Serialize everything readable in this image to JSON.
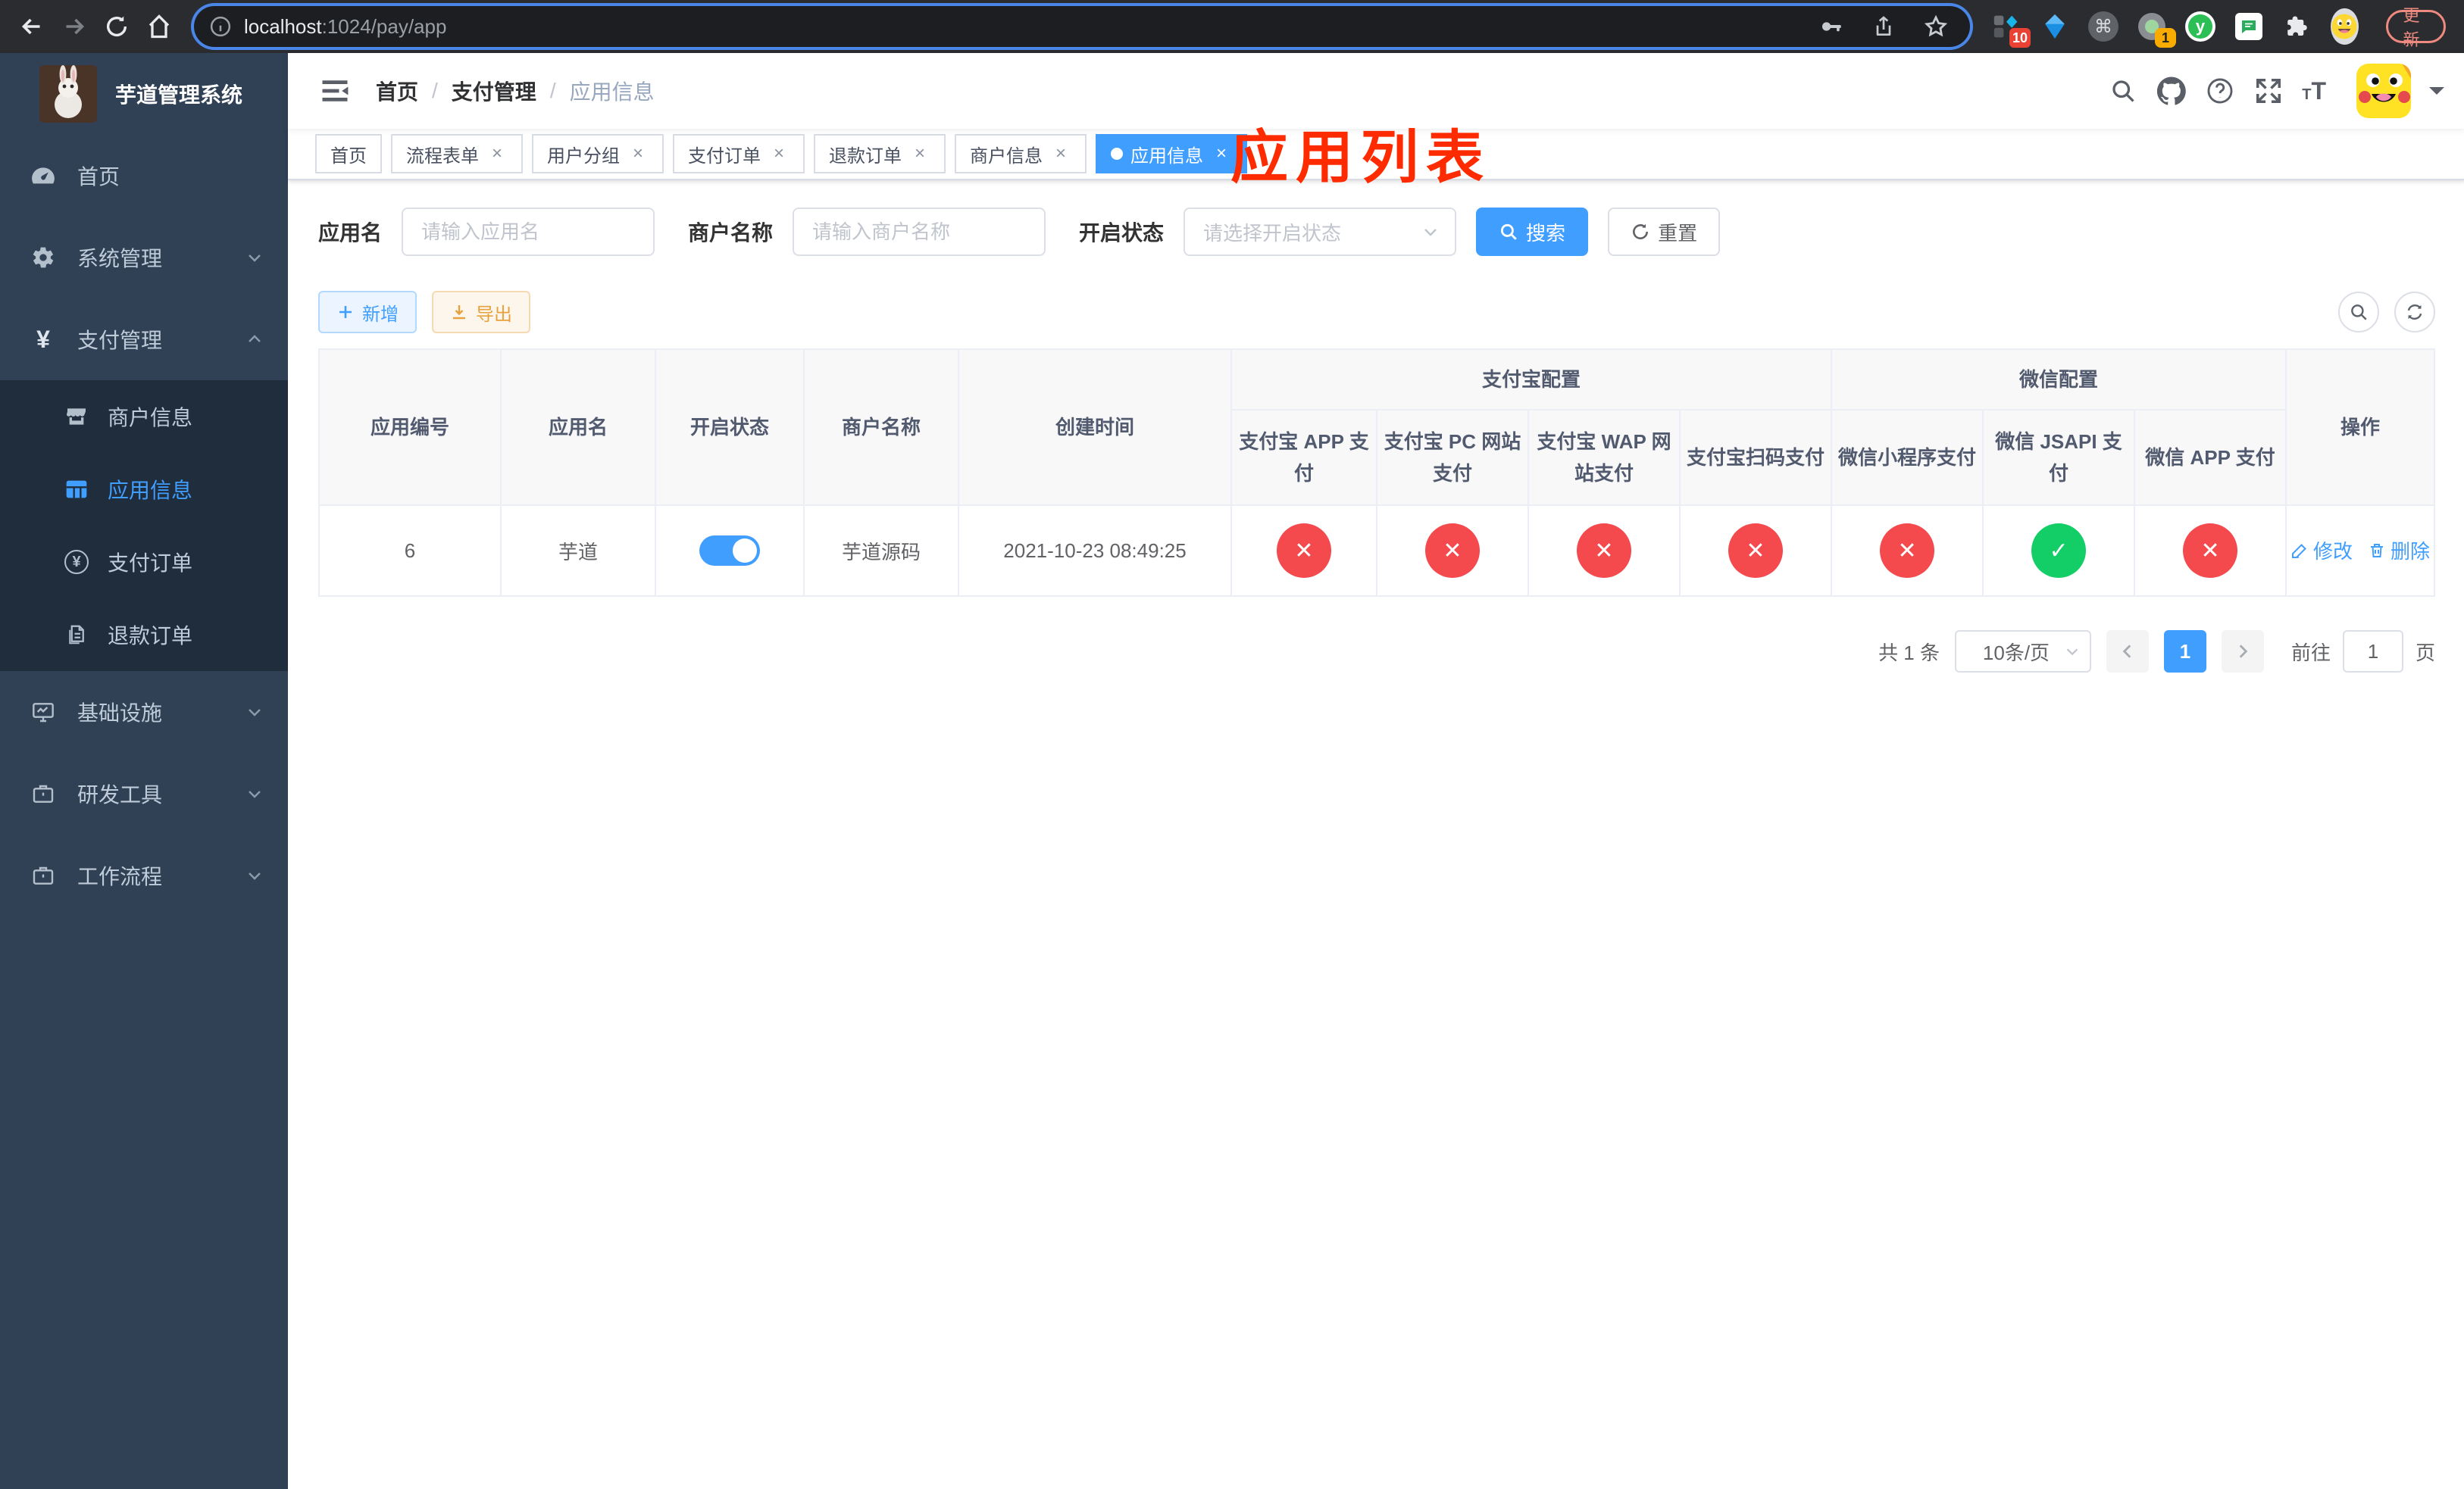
{
  "colors": {
    "accent_blue": "#409eff",
    "danger_red": "#f4494d",
    "success_green": "#13ce66",
    "annotation_red": "#fe2b00",
    "sidebar_bg": "#304156",
    "submenu_bg": "#1f2d3d",
    "chrome_update_red": "#ef8a80"
  },
  "glyphs": {
    "close": "×",
    "cross": "✕",
    "check": "✓",
    "command": "⌘",
    "y_letter": "y",
    "question": "?",
    "yen": "¥",
    "font_large": "T",
    "font_small": "T"
  },
  "browser": {
    "url_host": "localhost",
    "url_rest": ":1024/pay/app",
    "update_label": "更新",
    "ext_badge_red": "10",
    "ext_badge_orange": "1"
  },
  "sidebar": {
    "title": "芋道管理系统",
    "menu": [
      {
        "label": "首页"
      },
      {
        "label": "系统管理"
      },
      {
        "label": "支付管理"
      },
      {
        "label": "商户信息"
      },
      {
        "label": "应用信息"
      },
      {
        "label": "支付订单"
      },
      {
        "label": "退款订单"
      },
      {
        "label": "基础设施"
      },
      {
        "label": "研发工具"
      },
      {
        "label": "工作流程"
      }
    ]
  },
  "breadcrumb": {
    "separator": "/",
    "items": [
      "首页",
      "支付管理",
      "应用信息"
    ]
  },
  "annotation": "应用列表",
  "tabs": [
    {
      "label": "首页",
      "closable": false,
      "active": false
    },
    {
      "label": "流程表单",
      "closable": true,
      "active": false
    },
    {
      "label": "用户分组",
      "closable": true,
      "active": false
    },
    {
      "label": "支付订单",
      "closable": true,
      "active": false
    },
    {
      "label": "退款订单",
      "closable": true,
      "active": false
    },
    {
      "label": "商户信息",
      "closable": true,
      "active": false
    },
    {
      "label": "应用信息",
      "closable": true,
      "active": true
    }
  ],
  "filters": {
    "app_name_label": "应用名",
    "app_name_placeholder": "请输入应用名",
    "merchant_label": "商户名称",
    "merchant_placeholder": "请输入商户名称",
    "status_label": "开启状态",
    "status_placeholder": "请选择开启状态",
    "search_label": "搜索",
    "reset_label": "重置"
  },
  "toolbar": {
    "add_label": "新增",
    "export_label": "导出"
  },
  "table": {
    "headers": {
      "app_id": "应用编号",
      "app_name": "应用名",
      "status": "开启状态",
      "merchant": "商户名称",
      "created": "创建时间",
      "alipay_group": "支付宝配置",
      "wechat_group": "微信配置",
      "alipay_app": "支付宝 APP 支付",
      "alipay_pc": "支付宝 PC 网站支付",
      "alipay_wap": "支付宝 WAP 网站支付",
      "alipay_qr": "支付宝扫码支付",
      "wx_mini": "微信小程序支付",
      "wx_jsapi": "微信 JSAPI 支付",
      "wx_app": "微信 APP 支付",
      "actions": "操作"
    },
    "row": {
      "app_id": "6",
      "app_name": "芋道",
      "status_on": true,
      "merchant": "芋道源码",
      "created": "2021-10-23 08:49:25",
      "configs": [
        "disabled",
        "disabled",
        "disabled",
        "disabled",
        "disabled",
        "enabled",
        "disabled"
      ],
      "edit_label": "修改",
      "delete_label": "删除"
    }
  },
  "pagination": {
    "total": "共 1 条",
    "page_size": "10条/页",
    "current_page": "1",
    "goto_label": "前往",
    "goto_value": "1",
    "page_unit": "页"
  }
}
